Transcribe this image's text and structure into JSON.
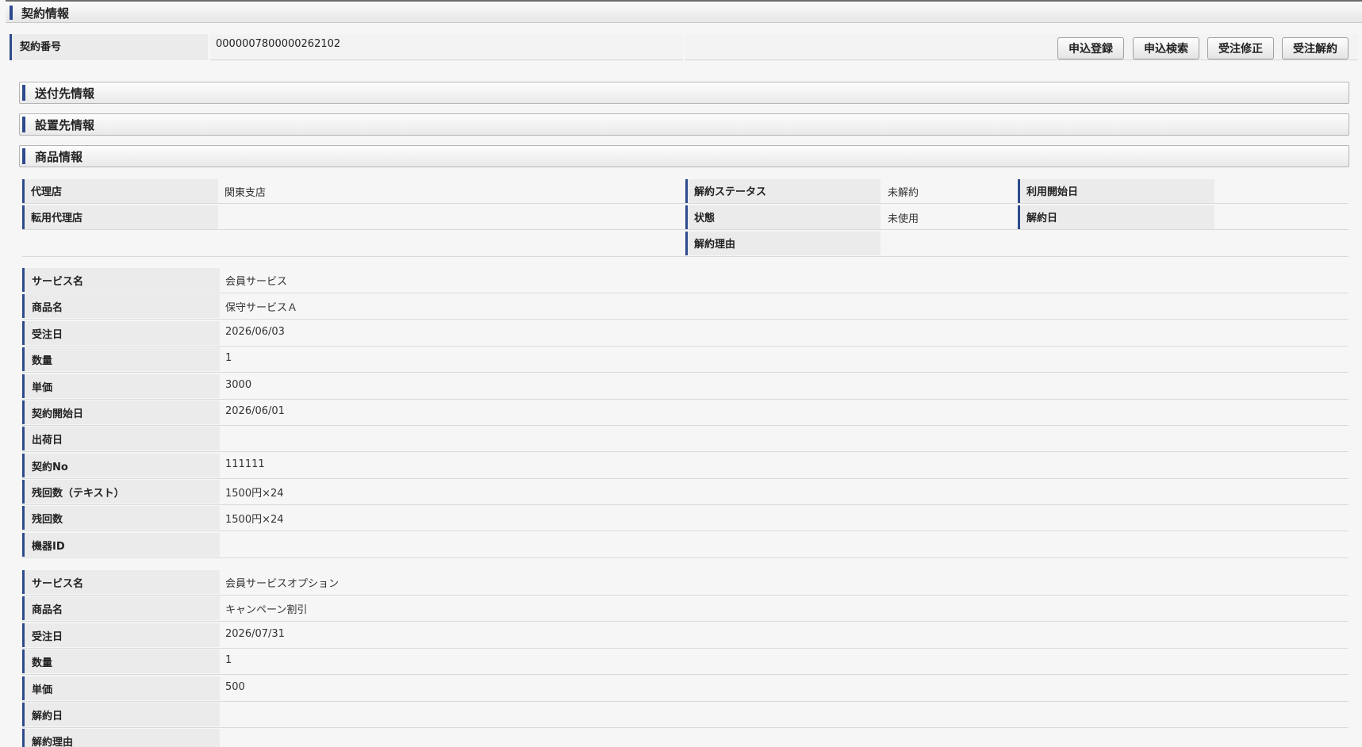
{
  "header": {
    "title": "契約情報"
  },
  "contract": {
    "label": "契約番号",
    "value": "0000007800000262102"
  },
  "buttons": [
    {
      "label": "申込登録"
    },
    {
      "label": "申込検索"
    },
    {
      "label": "受注修正"
    },
    {
      "label": "受注解約"
    }
  ],
  "sections": [
    {
      "title": "送付先情報"
    },
    {
      "title": "設置先情報"
    },
    {
      "title": "商品情報"
    }
  ],
  "product_info": {
    "agency_label": "代理店",
    "agency_value": "関東支店",
    "transfer_agency_label": "転用代理店",
    "transfer_agency_value": "",
    "cancel_status_label": "解約ステータス",
    "cancel_status_value": "未解約",
    "state_label": "状態",
    "state_value": "未使用",
    "cancel_reason_label": "解約理由",
    "cancel_reason_value": "",
    "use_start_label": "利用開始日",
    "use_start_value": "",
    "cancel_date_label": "解約日",
    "cancel_date_value": ""
  },
  "items1": [
    {
      "label": "サービス名",
      "value": "会員サービス"
    },
    {
      "label": "商品名",
      "value": "保守サービスＡ"
    },
    {
      "label": "受注日",
      "value": "2026/06/03"
    },
    {
      "label": "数量",
      "value": "1"
    },
    {
      "label": "単価",
      "value": "3000"
    },
    {
      "label": "契約開始日",
      "value": "2026/06/01"
    },
    {
      "label": "出荷日",
      "value": ""
    },
    {
      "label": "契約No",
      "value": "111111"
    },
    {
      "label": "残回数（テキスト）",
      "value": "1500円×24"
    },
    {
      "label": "残回数",
      "value": "1500円×24"
    },
    {
      "label": "機器ID",
      "value": ""
    }
  ],
  "items2": [
    {
      "label": "サービス名",
      "value": "会員サービスオプション"
    },
    {
      "label": "商品名",
      "value": "キャンペーン割引"
    },
    {
      "label": "受注日",
      "value": "2026/07/31"
    },
    {
      "label": "数量",
      "value": "1"
    },
    {
      "label": "単価",
      "value": "500"
    },
    {
      "label": "解約日",
      "value": ""
    },
    {
      "label": "解約理由",
      "value": ""
    }
  ]
}
